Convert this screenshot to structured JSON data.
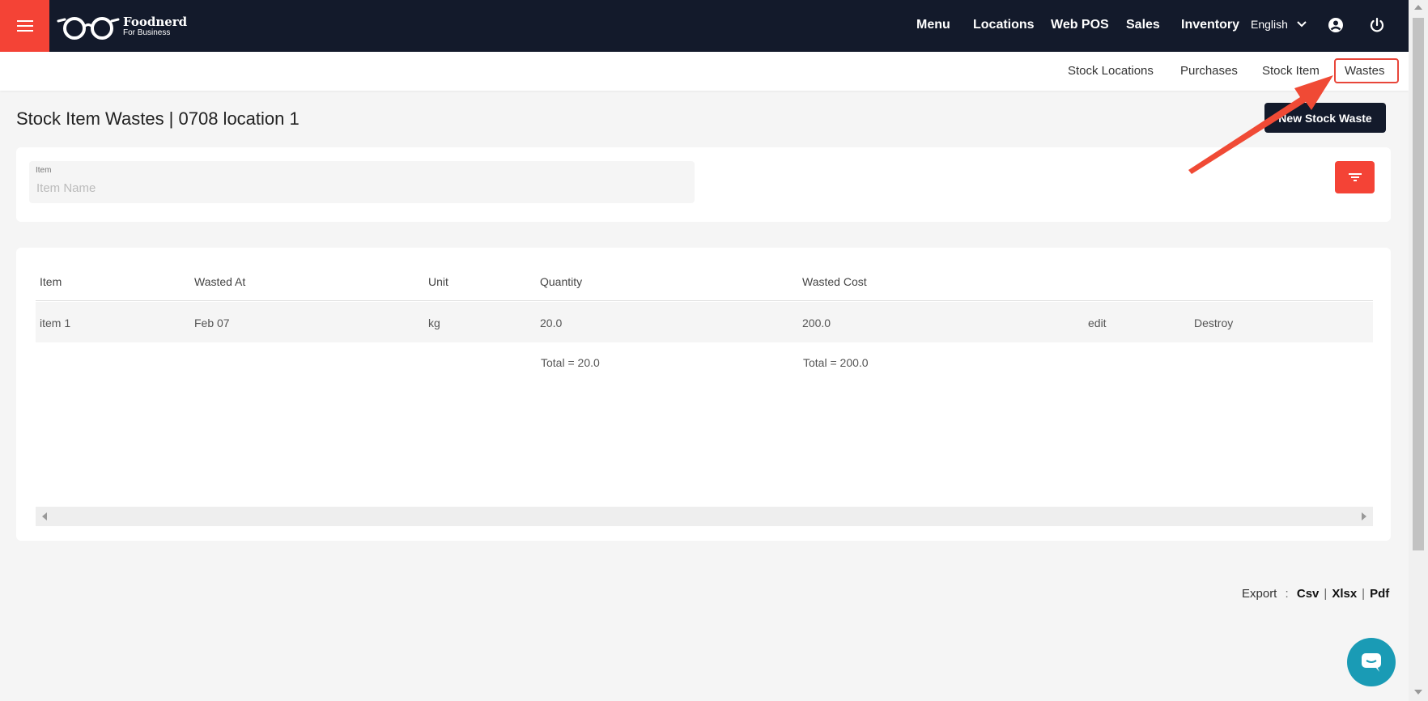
{
  "app": {
    "logo_name": "Foodnerd",
    "logo_sub": "For Business"
  },
  "topnav": {
    "items": [
      "Menu",
      "Locations",
      "Web POS",
      "Sales",
      "Inventory"
    ],
    "language": "English"
  },
  "subnav": {
    "items": [
      "Stock Locations",
      "Purchases",
      "Stock Item",
      "Wastes"
    ],
    "active": "Wastes"
  },
  "page": {
    "title": "Stock Item Wastes | 0708 location 1",
    "new_button": "New Stock Waste"
  },
  "filter": {
    "label": "Item",
    "placeholder": "Item Name"
  },
  "table": {
    "headers": [
      "Item",
      "Wasted At",
      "Unit",
      "Quantity",
      "Wasted Cost"
    ],
    "rows": [
      {
        "item": "item 1",
        "wasted_at": "Feb 07",
        "unit": "kg",
        "quantity": "20.0",
        "wasted_cost": "200.0",
        "edit": "edit",
        "destroy": "Destroy"
      }
    ],
    "totals": {
      "quantity": "Total = 20.0",
      "wasted_cost": "Total = 200.0"
    }
  },
  "export": {
    "label": "Export",
    "colon": ":",
    "formats": [
      "Csv",
      "Xlsx",
      "Pdf"
    ]
  },
  "colors": {
    "topbar": "#131a2b",
    "accent": "#f44336",
    "chat": "#1a9bb5"
  },
  "icons": {
    "menu": "hamburger-icon",
    "dropdown": "chevron-down-icon",
    "user": "user-circle-icon",
    "power": "power-icon",
    "filter": "filter-icon",
    "chat": "chat-icon"
  }
}
